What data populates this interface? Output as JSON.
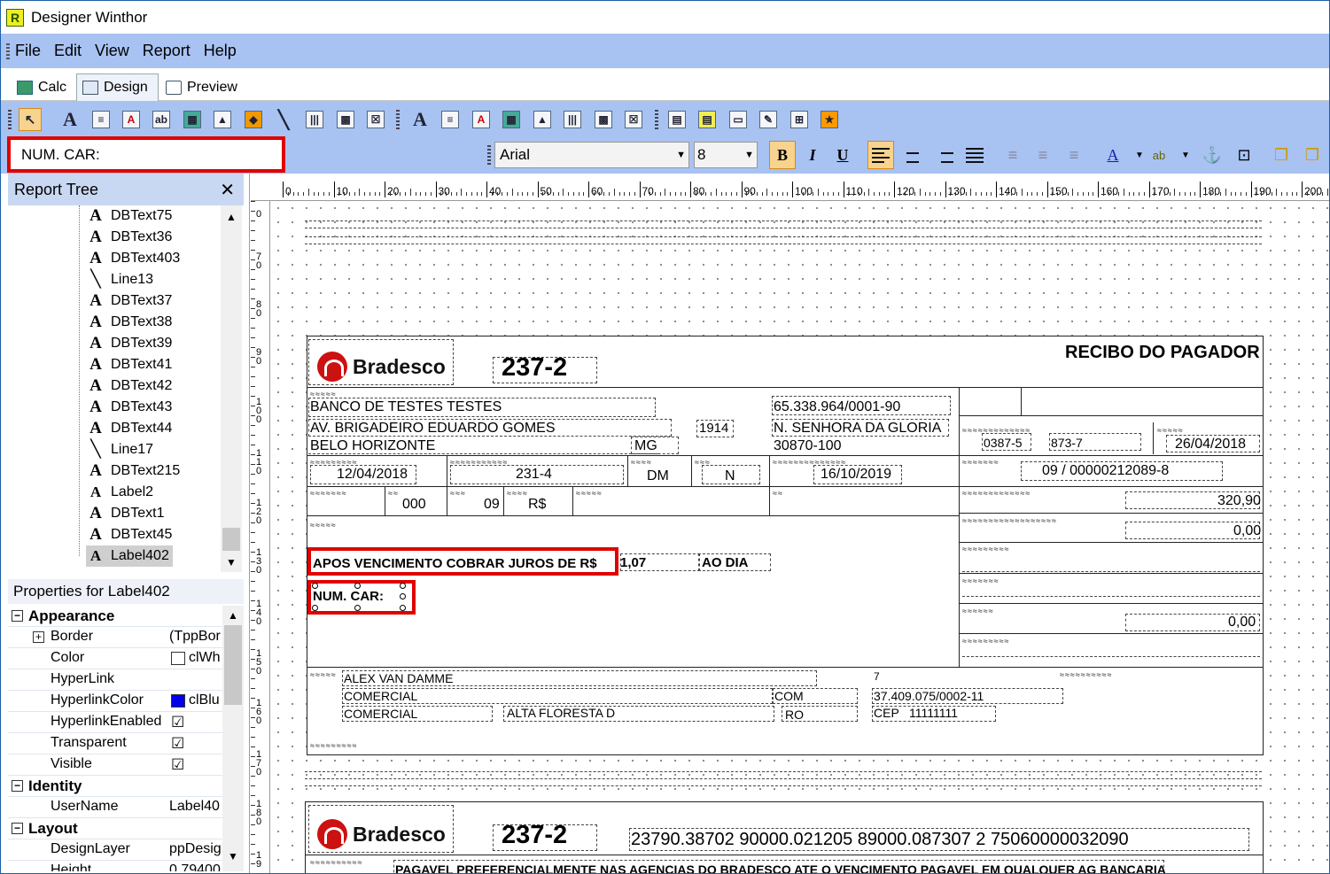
{
  "window": {
    "title": "Designer Winthor"
  },
  "menu": [
    "File",
    "Edit",
    "View",
    "Report",
    "Help"
  ],
  "tabs": [
    {
      "label": "Calc"
    },
    {
      "label": "Design",
      "active": true
    },
    {
      "label": "Preview"
    }
  ],
  "edit_toolbar": {
    "text_value": "NUM. CAR:",
    "font_name": "Arial",
    "font_size": "8",
    "bold_label": "B",
    "italic_label": "I",
    "underline_label": "U"
  },
  "report_tree": {
    "title": "Report Tree",
    "items": [
      {
        "label": "DBText75",
        "type": "dbtext"
      },
      {
        "label": "DBText36",
        "type": "dbtext"
      },
      {
        "label": "DBText403",
        "type": "dbtext"
      },
      {
        "label": "Line13",
        "type": "line"
      },
      {
        "label": "DBText37",
        "type": "dbtext"
      },
      {
        "label": "DBText38",
        "type": "dbtext"
      },
      {
        "label": "DBText39",
        "type": "dbtext"
      },
      {
        "label": "DBText41",
        "type": "dbtext"
      },
      {
        "label": "DBText42",
        "type": "dbtext"
      },
      {
        "label": "DBText43",
        "type": "dbtext"
      },
      {
        "label": "DBText44",
        "type": "dbtext"
      },
      {
        "label": "Line17",
        "type": "line"
      },
      {
        "label": "DBText215",
        "type": "dbtext"
      },
      {
        "label": "Label2",
        "type": "label"
      },
      {
        "label": "DBText1",
        "type": "dbtext"
      },
      {
        "label": "DBText45",
        "type": "dbtext"
      },
      {
        "label": "Label402",
        "type": "label",
        "selected": true
      }
    ]
  },
  "properties": {
    "title": "Properties for Label402",
    "categories": {
      "appearance": "Appearance",
      "identity": "Identity",
      "layout": "Layout"
    },
    "rows": [
      {
        "name": "Border",
        "value": "(TppBor",
        "expand": "+"
      },
      {
        "name": "Color",
        "value": "clWh",
        "swatch": "#ffffff"
      },
      {
        "name": "HyperLink",
        "value": ""
      },
      {
        "name": "HyperlinkColor",
        "value": "clBlu",
        "swatch": "#0000ee"
      },
      {
        "name": "HyperlinkEnabled",
        "value": "",
        "checked": true
      },
      {
        "name": "Transparent",
        "value": "",
        "checked": true
      },
      {
        "name": "Visible",
        "value": "",
        "checked": true
      },
      {
        "name": "UserName",
        "value": "Label40"
      },
      {
        "name": "DesignLayer",
        "value": "ppDesig"
      },
      {
        "name": "Height",
        "value": "0,79400"
      }
    ]
  },
  "ruler": {
    "top_labels": [
      "0",
      "10",
      "20",
      "30",
      "40",
      "50",
      "60",
      "70",
      "80",
      "90",
      "100",
      "110",
      "120",
      "130",
      "140",
      "150",
      "160",
      "170",
      "180",
      "190",
      "200"
    ],
    "left_labels": [
      "0",
      "7\n0",
      "8\n0",
      "9\n0",
      "1\n0\n0",
      "1\n1\n0",
      "1\n2\n0",
      "1\n3\n0",
      "1\n4\n0",
      "1\n5\n0",
      "1\n6\n0",
      "1\n7\n0",
      "1\n8\n0",
      "1\n9"
    ]
  },
  "boleto": {
    "bank_name": "Bradesco",
    "bank_code": "237-2",
    "receipt_title": "RECIBO DO PAGADOR",
    "beneficiary": "BANCO DE TESTES TESTES",
    "cnpj": "65.338.964/0001-90",
    "address": "AV. BRIGADEIRO EDUARDO GOMES",
    "address_number": "1914",
    "neighborhood": "N. SENHORA DA GLORIA",
    "city": "BELO HORIZONTE",
    "state": "MG",
    "zip": "30870-100",
    "agency": "0387-5",
    "account": "873-7",
    "due_date": "26/04/2018",
    "doc_date": "12/04/2018",
    "doc_number": "231-4",
    "species": "DM",
    "accept": "N",
    "processing_date": "16/10/2019",
    "our_number": "09 / 00000212089-8",
    "cip": "000",
    "wallet": "09",
    "currency": "R$",
    "doc_value": "320,90",
    "discount": "0,00",
    "charged": "0,00",
    "interest_text": "APOS VENCIMENTO COBRAR JUROS DE R$",
    "interest_value": "1,07",
    "interest_period": "AO DIA",
    "num_car_label": "NUM. CAR:",
    "payer_name": "ALEX VAN DAMME",
    "payer_line1": "COMERCIAL",
    "payer_line2": "COMERCIAL",
    "payer_city": "ALTA FLORESTA D",
    "payer_com": "COM",
    "payer_state": "RO",
    "payer_cnpj_digit": "7",
    "payer_cnpj": "37.409.075/0002-11",
    "payer_cep_label": "CEP",
    "payer_cep": "11111111",
    "digitable_line": "23790.38702  90000.021205  89000.087307  2  75060000032090",
    "payment_place": "PAGAVEL PREFERENCIALMENTE NAS  AGENCIAS  DO BRADESCO ATE O VENCIMENTO  PAGAVEL  EM QUALQUER AG BANCARIA"
  }
}
